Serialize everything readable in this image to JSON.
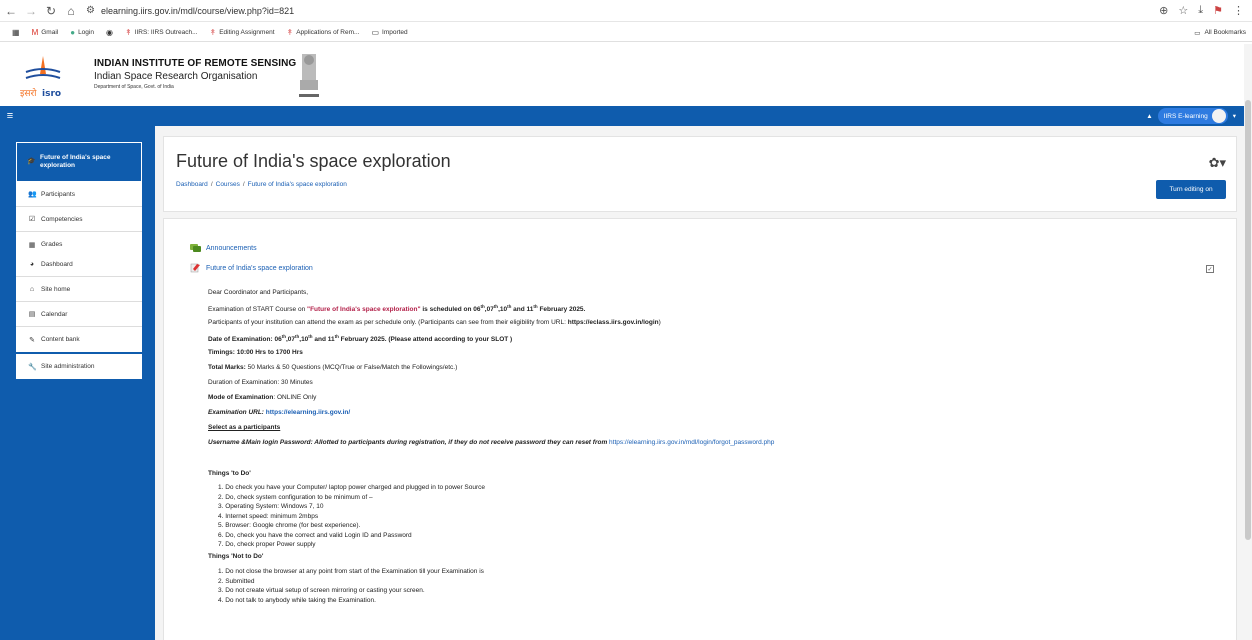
{
  "browser": {
    "url": "elearning.iirs.gov.in/mdl/course/view.php?id=821",
    "bookmarks": [
      {
        "label": "Gmail"
      },
      {
        "label": "Login"
      },
      {
        "label": ""
      },
      {
        "label": "IIRS: IIRS Outreach..."
      },
      {
        "label": "Editing Assignment"
      },
      {
        "label": "Applications of Rem..."
      },
      {
        "label": "Imported"
      }
    ],
    "all_bookmarks": "All Bookmarks"
  },
  "site": {
    "inst_title": "INDIAN INSTITUTE OF REMOTE SENSING",
    "org_name": "Indian Space Research Organisation",
    "dept": "Department of Space, Govt. of India"
  },
  "navbar": {
    "user_label": "IIRS E-learning"
  },
  "sidebar": {
    "course": "Future of India's space exploration",
    "course_items": [
      {
        "label": "Participants",
        "icon": "users-icon"
      },
      {
        "label": "Competencies",
        "icon": "check-square-icon"
      },
      {
        "label": "Grades",
        "icon": "table-icon"
      }
    ],
    "nav_items": [
      {
        "label": "Dashboard",
        "icon": "dashboard-icon"
      },
      {
        "label": "Site home",
        "icon": "home-icon"
      },
      {
        "label": "Calendar",
        "icon": "calendar-icon"
      },
      {
        "label": "Content bank",
        "icon": "pen-icon"
      }
    ],
    "admin_item": {
      "label": "Site administration",
      "icon": "wrench-icon"
    }
  },
  "header": {
    "title": "Future of India's space exploration",
    "breadcrumb": [
      "Dashboard",
      "Courses",
      "Future of India's space exploration"
    ],
    "turn_editing": "Turn editing on"
  },
  "content": {
    "announcements": "Announcements",
    "assignment": "Future of India's space exploration",
    "greeting": "Dear Coordinator and Participants,",
    "exam_line_pre": "Examination of START Course on ",
    "exam_course": "\"Future of India's space exploration\"",
    "exam_line_mid": " is scheduled on ",
    "exam_dates_a": "06",
    "exam_dates_b": "07",
    "exam_dates_c": "10",
    "exam_dates_d": "11",
    "exam_sup": "th",
    "exam_month": " February 2025.",
    "eligibility_pre": "Participants of your institution can attend the exam as per schedule only. (Participants can see from their eligibility from URL: ",
    "eligibility_url": "https://eclass.iirs.gov.in/login",
    "eligibility_post": ")",
    "date_label": "Date of Examination: ",
    "date_rest": " February 2025. (Please attend according to your SLOT )",
    "timings": "Timings: 10:00 Hrs to 1700 Hrs",
    "total_marks_label": "Total Marks:",
    "total_marks": " 50 Marks & 50 Questions (MCQ/True or False/Match the Followings/etc.)",
    "duration": "Duration of Examination: 30 Minutes",
    "mode_label": "Mode of Examination",
    "mode": ": ONLINE Only",
    "exam_url_label": "Examination URL: ",
    "exam_url": "https://elearning.iirs.gov.in/",
    "select_as": "Select as a participants",
    "username_label": "Username &Main login Password:  Allotted to participants during registration, if they do not receive password they can reset from ",
    "reset_url": "https://elearning.iirs.gov.in/mdl/login/forgot_password.php",
    "todo_title": "Things 'to Do'",
    "todo": [
      "1. Do check you have your Computer/ laptop power charged and plugged in to power Source",
      "2. Do, check system configuration to be minimum of –",
      "3. Operating System: Windows 7, 10",
      "4. Internet speed: minimum 2mbps",
      "5. Browser: Google chrome (for best experience).",
      "6. Do, check you have the correct and valid Login ID and Password",
      "7. Do, check proper Power supply"
    ],
    "nottodo_title": "Things 'Not to Do'",
    "nottodo": [
      "1. Do not close the browser at any point from start of the Examination till your Examination is",
      "2. Submitted",
      "3. Do not create virtual setup of screen mirroring or casting your screen.",
      "4. Do not talk to anybody while taking the Examination."
    ]
  }
}
